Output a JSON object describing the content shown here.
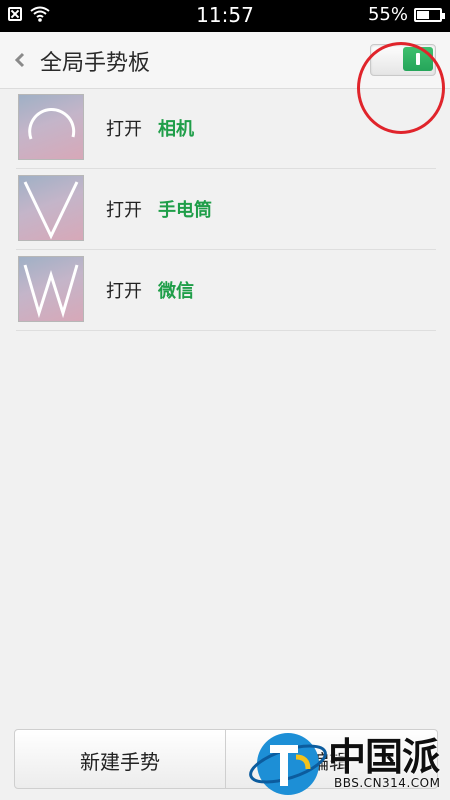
{
  "status_bar": {
    "time": "11:57",
    "battery_text": "55%",
    "battery_level": 0.55,
    "icons": [
      "no-sim-icon",
      "wifi-icon",
      "battery-icon"
    ]
  },
  "header": {
    "title": "全局手势板",
    "back_icon": "chevron-left-icon",
    "toggle_on": true
  },
  "gestures": [
    {
      "action": "打开",
      "target": "相机",
      "glyph": "arc"
    },
    {
      "action": "打开",
      "target": "手电筒",
      "glyph": "V"
    },
    {
      "action": "打开",
      "target": "微信",
      "glyph": "W"
    }
  ],
  "bottom_bar": {
    "new_label": "新建手势",
    "edit_label": "编辑"
  },
  "watermark": {
    "text": "中国派",
    "subtext": "BBS.CN314.COM"
  },
  "colors": {
    "accent_green": "#1f9e49",
    "toggle_green": "#2db463",
    "annotation_red": "#e0242b",
    "background": "#f1f1f1"
  }
}
